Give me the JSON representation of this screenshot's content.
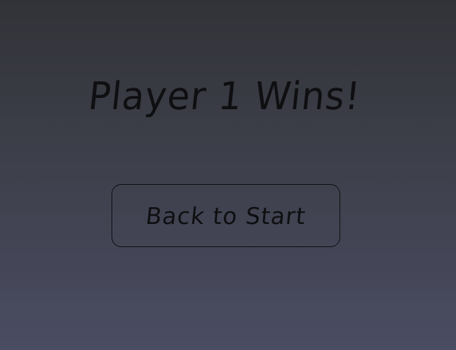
{
  "end_screen": {
    "title": "Player 1 Wins!",
    "back_button_label": "Back to Start"
  },
  "colors": {
    "background_top": "#323338",
    "background_bottom": "#4a4c62",
    "text": "#0f0f12",
    "button_border": "#0d0d10"
  }
}
